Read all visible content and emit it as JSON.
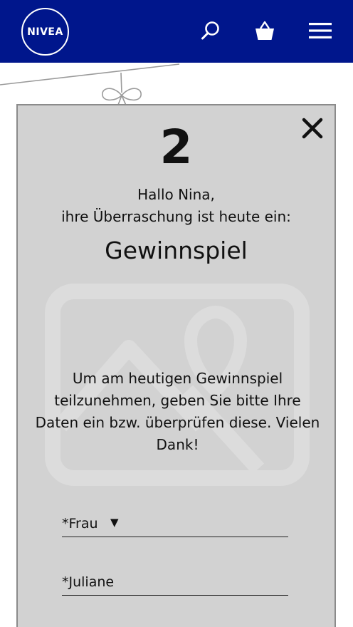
{
  "header": {
    "logo_text": "NIVEA",
    "background_color": "#00168c",
    "icons": [
      "search-icon",
      "shopping-basket-icon",
      "hamburger-menu-icon"
    ]
  },
  "popup": {
    "background_color": "#d2d2d2",
    "day_number": "2",
    "greeting_line1": "Hallo Nina,",
    "greeting_line2": "ihre Überraschung ist heute ein:",
    "surprise_title": "Gewinnspiel",
    "instructions": "Um am heutigen Gewinnspiel teilzunehmen, geben Sie bitte Ihre Daten ein bzw. überprüfen diese. Vielen Dank!",
    "close_icon": "close-icon",
    "image_placeholder_icon": "image-placeholder-icon"
  },
  "form": {
    "salutation_value": "*Frau",
    "firstname_value": "*Juliane"
  }
}
